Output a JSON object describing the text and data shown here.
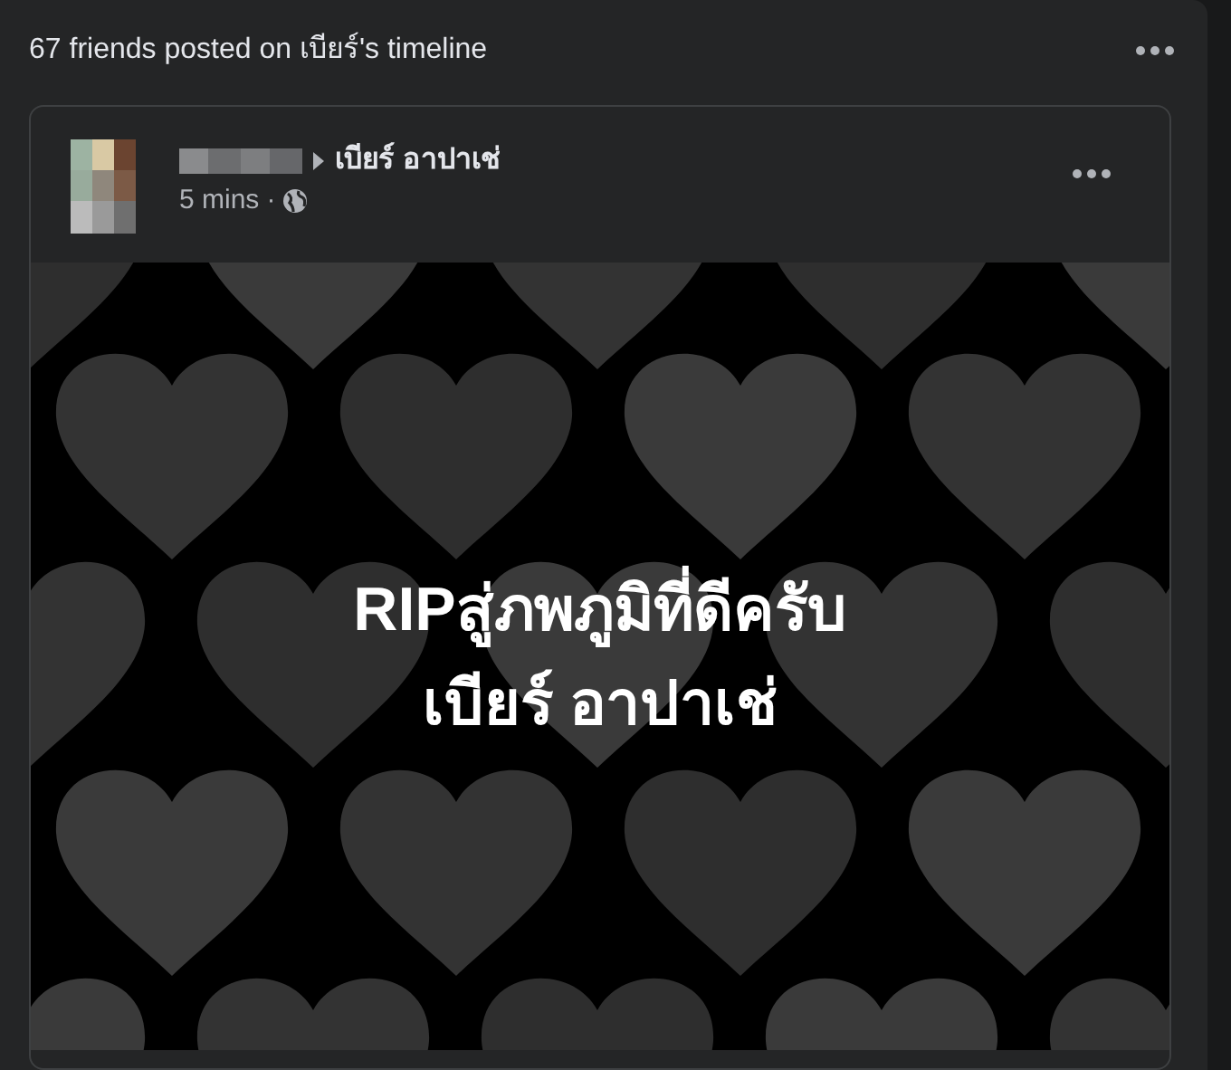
{
  "header": {
    "text": "67 friends posted on เบียร์'s timeline"
  },
  "post": {
    "recipient": "เบียร์ อาปาเช่",
    "time": "5 mins",
    "separator": "·",
    "body_lines": [
      "RIPสู่ภพภูมิที่ดีครับ",
      "เบียร์ อาปาเช่"
    ]
  }
}
